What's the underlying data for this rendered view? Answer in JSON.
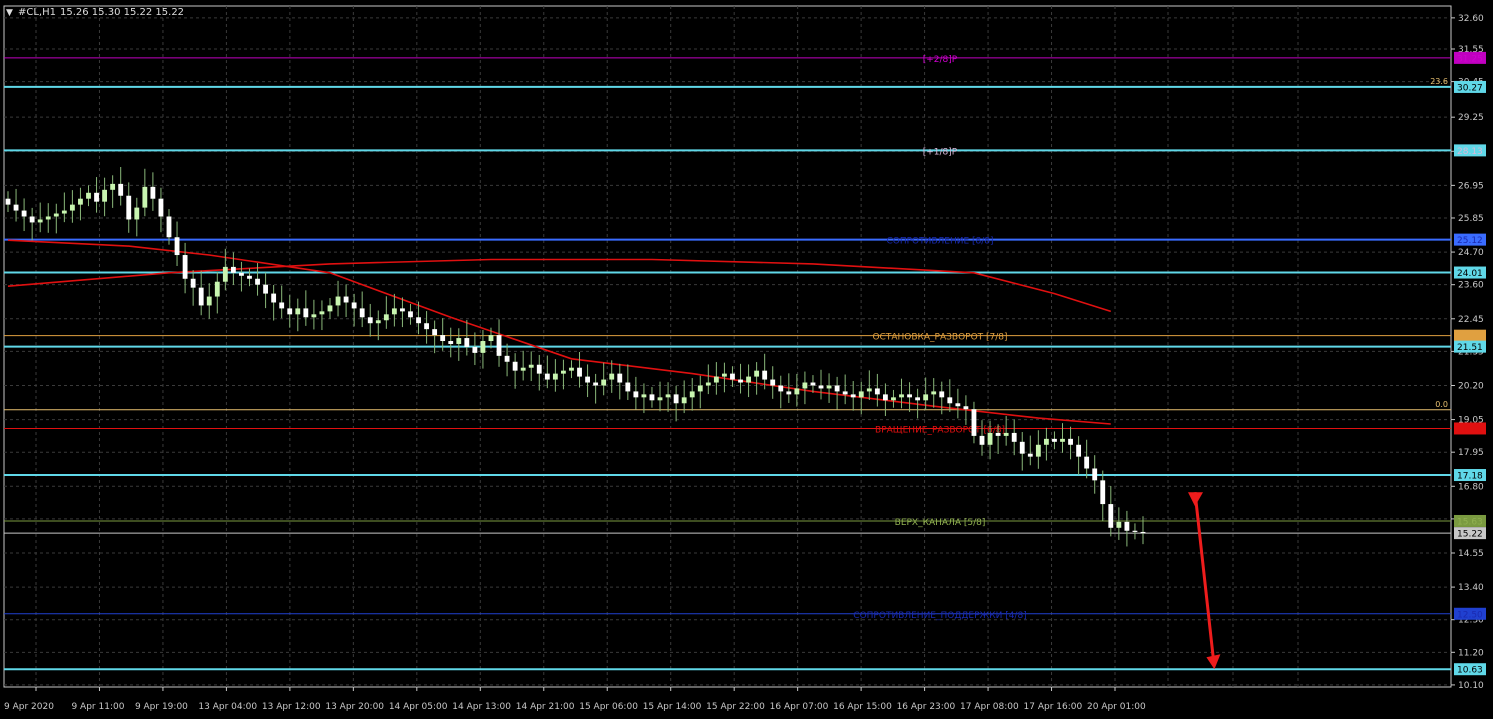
{
  "header": {
    "symbol_label": "#CL,H1",
    "ohlc": "15.26 15.30 15.22 15.22"
  },
  "colors": {
    "background": "#000000",
    "grid": "#3a3a3a",
    "axis": "#c8c8c8",
    "bull": "#c8f5b0",
    "bear": "#ffffff",
    "wick": "#8ab87a",
    "ma": "#e01010",
    "arrow": "#ee1c1c",
    "fractal": "#777777"
  },
  "chart_data": {
    "type": "candlestick",
    "instrument": "#CL",
    "timeframe": "H1",
    "last_price": 15.22,
    "y_range": [
      10.03,
      33.0
    ],
    "y_ticks": [
      "32.60",
      "31.55",
      "30.45",
      "29.25",
      "28.10",
      "26.95",
      "25.85",
      "24.70",
      "23.60",
      "22.45",
      "21.35",
      "20.20",
      "19.05",
      "17.95",
      "16.80",
      "15.70",
      "14.55",
      "13.40",
      "12.30",
      "11.20",
      "10.10"
    ],
    "y_tick_values": [
      32.6,
      31.55,
      30.45,
      29.25,
      28.1,
      26.95,
      25.85,
      24.7,
      23.6,
      22.45,
      21.35,
      20.2,
      19.05,
      17.95,
      16.8,
      15.7,
      14.55,
      13.4,
      12.3,
      11.2,
      10.1
    ],
    "x_labels": [
      "9 Apr 2020",
      "9 Apr 11:00",
      "9 Apr 19:00",
      "13 Apr 04:00",
      "13 Apr 12:00",
      "13 Apr 20:00",
      "14 Apr 05:00",
      "14 Apr 13:00",
      "14 Apr 21:00",
      "15 Apr 06:00",
      "15 Apr 14:00",
      "15 Apr 22:00",
      "16 Apr 07:00",
      "16 Apr 15:00",
      "16 Apr 23:00",
      "17 Apr 08:00",
      "17 Apr 16:00",
      "20 Apr 01:00"
    ],
    "levels": [
      {
        "value": 31.25,
        "label": "31.25",
        "tag": "[+2/8]P",
        "color": "#c000c0",
        "text_color": "#d000d0",
        "width": 1
      },
      {
        "value": 30.27,
        "label": "30.27",
        "tag": "",
        "color": "#60d8e8",
        "text_color": "#000000",
        "width": 2
      },
      {
        "value": 28.13,
        "label": "28.13",
        "tag": "[+1/8]P",
        "color": "#60d8e8",
        "text_color": "#d8b8d8",
        "width": 2
      },
      {
        "value": 25.12,
        "label": "25.12",
        "tag": "СОПРОТИВЛЕНИЕ [8/8]",
        "color": "#3a6cff",
        "text_color": "#1a2ab0",
        "width": 2
      },
      {
        "value": 24.01,
        "label": "24.01",
        "tag": "",
        "color": "#60d8e8",
        "text_color": "#000000",
        "width": 2
      },
      {
        "value": 21.88,
        "label": "21.88",
        "tag": "ОСТАНОВКА_РАЗВОРОТ [7/8]",
        "color": "#e0a040",
        "text_color": "#e0a040",
        "width": 1
      },
      {
        "value": 21.51,
        "label": "21.51",
        "tag": "",
        "color": "#60d8e8",
        "text_color": "#000000",
        "width": 2
      },
      {
        "value": 19.38,
        "label": "",
        "tag": "",
        "color": "#e8c070",
        "text_color": "#e8c070",
        "width": 1
      },
      {
        "value": 18.75,
        "label": "18.75",
        "tag": "ВРАЩЕНИЕ_РАЗВОРОТ [6/8]",
        "color": "#e01010",
        "text_color": "#e01010",
        "width": 1
      },
      {
        "value": 17.18,
        "label": "17.18",
        "tag": "",
        "color": "#60d8e8",
        "text_color": "#000000",
        "width": 2
      },
      {
        "value": 15.63,
        "label": "15.63",
        "tag": "ВЕРХ_КАНАЛА [5/8]",
        "color": "#7a9a40",
        "text_color": "#90b050",
        "width": 1
      },
      {
        "value": 15.22,
        "label": "15.22",
        "tag": "",
        "color": "#c8c8c8",
        "text_color": "#000000",
        "width": 1
      },
      {
        "value": 12.5,
        "label": "12.50",
        "tag": "СОПРОТИВЛЕНИЕ_ПОДДЕРЖКИ [4/8]",
        "color": "#2040d0",
        "text_color": "#1a2ab0",
        "width": 1
      },
      {
        "value": 10.63,
        "label": "10.63",
        "tag": "",
        "color": "#60d8e8",
        "text_color": "#000000",
        "width": 2
      }
    ],
    "fib_annotations": [
      {
        "value": 30.27,
        "text": "23.6"
      },
      {
        "value": 19.38,
        "text": "0.0"
      }
    ],
    "close_series": [
      26.3,
      26.1,
      25.9,
      25.7,
      25.8,
      25.9,
      26.0,
      26.1,
      26.3,
      26.5,
      26.7,
      26.4,
      26.8,
      27.0,
      26.6,
      25.8,
      26.2,
      26.9,
      26.5,
      25.9,
      25.2,
      24.6,
      23.8,
      23.5,
      22.9,
      23.2,
      23.7,
      24.2,
      24.0,
      23.9,
      23.8,
      23.6,
      23.3,
      23.0,
      22.8,
      22.6,
      22.8,
      22.5,
      22.6,
      22.7,
      22.9,
      23.2,
      23.0,
      22.8,
      22.5,
      22.3,
      22.4,
      22.6,
      22.8,
      22.7,
      22.5,
      22.3,
      22.1,
      21.9,
      21.7,
      21.6,
      21.8,
      21.5,
      21.3,
      21.7,
      21.9,
      21.2,
      21.0,
      20.7,
      20.8,
      20.9,
      20.6,
      20.4,
      20.6,
      20.7,
      20.8,
      20.5,
      20.3,
      20.2,
      20.4,
      20.6,
      20.3,
      20.0,
      19.8,
      19.9,
      19.7,
      19.8,
      19.9,
      19.6,
      19.8,
      20.0,
      20.2,
      20.3,
      20.5,
      20.6,
      20.4,
      20.3,
      20.5,
      20.7,
      20.4,
      20.2,
      20.0,
      19.9,
      20.1,
      20.3,
      20.2,
      20.1,
      20.2,
      20.0,
      19.9,
      19.8,
      20.0,
      20.1,
      19.9,
      19.7,
      19.8,
      19.9,
      19.8,
      19.7,
      19.9,
      20.0,
      19.8,
      19.6,
      19.5,
      19.4,
      18.5,
      18.2,
      18.6,
      18.5,
      18.6,
      18.3,
      17.9,
      17.8,
      18.2,
      18.4,
      18.3,
      18.4,
      18.2,
      17.8,
      17.4,
      17.0,
      16.2,
      15.4,
      15.6,
      15.3,
      15.26,
      15.22
    ],
    "ma_series": [
      {
        "name": "",
        "points": [
          [
            0,
            23.55
          ],
          [
            20,
            24.0
          ],
          [
            40,
            24.3
          ],
          [
            60,
            24.45
          ],
          [
            80,
            24.45
          ],
          [
            100,
            24.3
          ],
          [
            120,
            24.0
          ],
          [
            130,
            23.3
          ],
          [
            137,
            22.7
          ]
        ],
        "start_index": 0
      },
      {
        "name": "",
        "points": [
          [
            0,
            25.1
          ],
          [
            15,
            24.9
          ],
          [
            25,
            24.6
          ],
          [
            40,
            24.0
          ],
          [
            55,
            22.5
          ],
          [
            70,
            21.1
          ],
          [
            85,
            20.6
          ],
          [
            100,
            20.0
          ],
          [
            115,
            19.5
          ],
          [
            128,
            19.1
          ],
          [
            137,
            18.9
          ]
        ],
        "start_index": 0
      }
    ],
    "forecast_arrow": {
      "from": [
        143.5,
        16.6
      ],
      "to": [
        145.8,
        10.63
      ]
    }
  }
}
